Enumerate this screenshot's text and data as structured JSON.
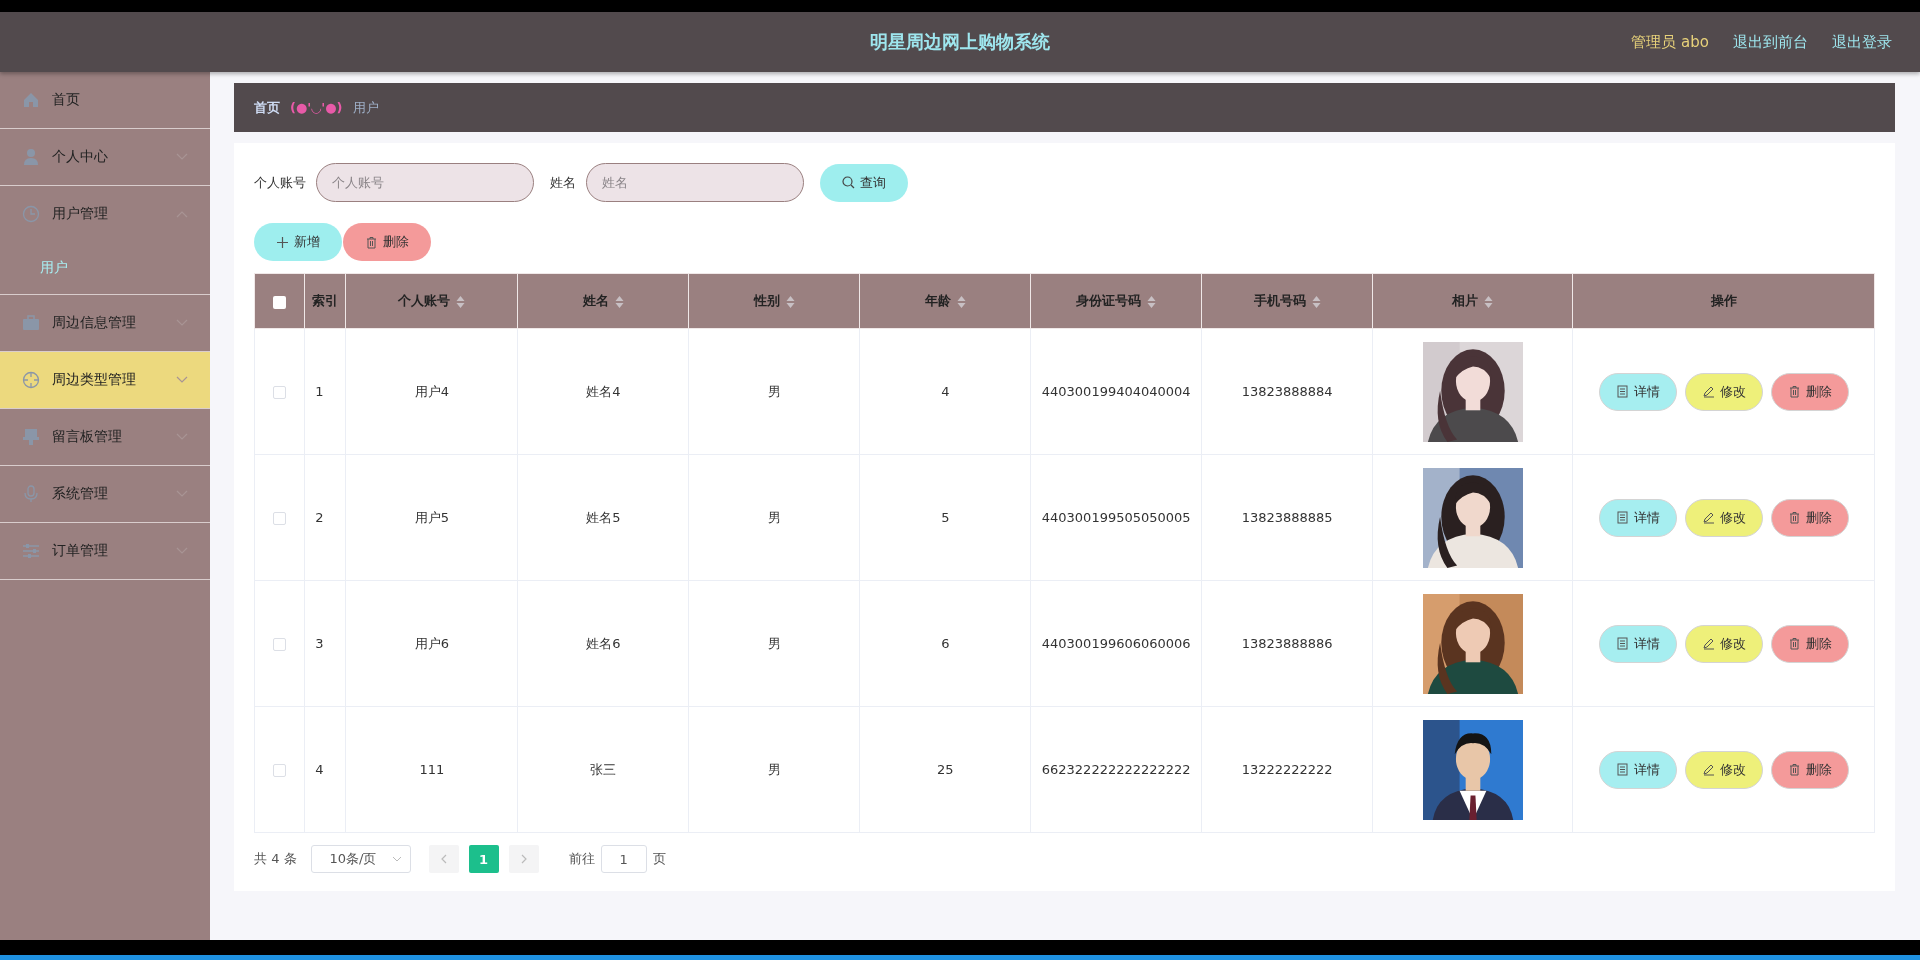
{
  "header": {
    "title": "明星周边网上购物系统",
    "user": "管理员 abo",
    "links": [
      "退出到前台",
      "退出登录"
    ]
  },
  "sidebar": {
    "items": [
      {
        "label": "首页",
        "expandable": false,
        "highlighted": false
      },
      {
        "label": "个人中心",
        "expandable": true,
        "expanded": false,
        "highlighted": false
      },
      {
        "label": "用户管理",
        "expandable": true,
        "expanded": true,
        "highlighted": false,
        "children": [
          {
            "label": "用户"
          }
        ]
      },
      {
        "label": "周边信息管理",
        "expandable": true,
        "expanded": false,
        "highlighted": false
      },
      {
        "label": "周边类型管理",
        "expandable": true,
        "expanded": false,
        "highlighted": true
      },
      {
        "label": "留言板管理",
        "expandable": true,
        "expanded": false,
        "highlighted": false
      },
      {
        "label": "系统管理",
        "expandable": true,
        "expanded": false,
        "highlighted": false
      },
      {
        "label": "订单管理",
        "expandable": true,
        "expanded": false,
        "highlighted": false
      }
    ]
  },
  "breadcrumb": {
    "home": "首页",
    "separator": "(●'◡'●)",
    "current": "用户"
  },
  "search": {
    "fields": [
      {
        "label": "个人账号",
        "placeholder": "个人账号"
      },
      {
        "label": "姓名",
        "placeholder": "姓名"
      }
    ],
    "button": "查询"
  },
  "toolbar": [
    {
      "kind": "add",
      "label": "新增"
    },
    {
      "kind": "delete",
      "label": "删除"
    }
  ],
  "table": {
    "header_checkbox": {
      "checked": false
    },
    "columns": [
      {
        "label": "索引",
        "sortable": false
      },
      {
        "label": "个人账号",
        "sortable": true
      },
      {
        "label": "姓名",
        "sortable": true
      },
      {
        "label": "性别",
        "sortable": true
      },
      {
        "label": "年龄",
        "sortable": true
      },
      {
        "label": "身份证号码",
        "sortable": true
      },
      {
        "label": "手机号码",
        "sortable": true
      },
      {
        "label": "相片",
        "sortable": true
      },
      {
        "label": "操作",
        "sortable": false
      }
    ],
    "rows": [
      {
        "checked": false,
        "cells": [
          "1",
          "用户4",
          "姓名4",
          "男",
          "4",
          "440300199404040004",
          "13823888884"
        ],
        "photo": {
          "kind": "picture"
        },
        "actions": [
          {
            "kind": "detail",
            "label": "详情"
          },
          {
            "kind": "edit",
            "label": "修改"
          },
          {
            "kind": "delete",
            "label": "删除"
          }
        ]
      },
      {
        "checked": false,
        "cells": [
          "2",
          "用户5",
          "姓名5",
          "男",
          "5",
          "440300199505050005",
          "13823888885"
        ],
        "photo": {
          "kind": "picture"
        },
        "actions": [
          {
            "kind": "detail",
            "label": "详情"
          },
          {
            "kind": "edit",
            "label": "修改"
          },
          {
            "kind": "delete",
            "label": "删除"
          }
        ]
      },
      {
        "checked": false,
        "cells": [
          "3",
          "用户6",
          "姓名6",
          "男",
          "6",
          "440300199606060006",
          "13823888886"
        ],
        "photo": {
          "kind": "picture"
        },
        "actions": [
          {
            "kind": "detail",
            "label": "详情"
          },
          {
            "kind": "edit",
            "label": "修改"
          },
          {
            "kind": "delete",
            "label": "删除"
          }
        ]
      },
      {
        "checked": false,
        "cells": [
          "4",
          "111",
          "张三",
          "男",
          "25",
          "662322222222222222",
          "13222222222"
        ],
        "photo": {
          "kind": "picture"
        },
        "actions": [
          {
            "kind": "detail",
            "label": "详情"
          },
          {
            "kind": "edit",
            "label": "修改"
          },
          {
            "kind": "delete",
            "label": "删除"
          }
        ]
      }
    ]
  },
  "pagination": {
    "total": "共 4 条",
    "page_size": "10条/页",
    "pages": [
      {
        "label": "1",
        "selected": true
      }
    ],
    "goto_label": "前往",
    "goto_value": "1",
    "page_unit": "页"
  }
}
